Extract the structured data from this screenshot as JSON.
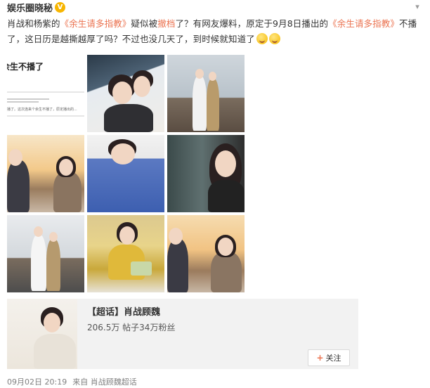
{
  "post": {
    "author": "娱乐圈晓秘",
    "verified_badge": "V",
    "more_icon": "chevron-down-icon",
    "text_parts": [
      {
        "t": "肖战和杨紫的",
        "hl": false
      },
      {
        "t": "《余生请多指教》",
        "hl": true
      },
      {
        "t": "疑似被",
        "hl": false
      },
      {
        "t": "撤档",
        "hl": true
      },
      {
        "t": "了？有网友爆料，原定于9月8日播出的",
        "hl": false
      },
      {
        "t": "《余生请多指教》",
        "hl": true
      },
      {
        "t": "不播了，这日历是越撕越厚了吗？不过也没几天了，到时候就知道了",
        "hl": false
      }
    ],
    "emoji_names": [
      "smile-emoji",
      "smile-emoji"
    ]
  },
  "grid": {
    "tile1": {
      "title": "余生不播了",
      "snippet": "播了。这次连来个余生不播了，原定播出的..."
    }
  },
  "supertopic": {
    "title": "【超话】肖战顾魏",
    "stats": "206.5万  帖子34万粉丝",
    "follow_label": "关注",
    "plus_icon": "plus-icon"
  },
  "footer": {
    "date": "09月02日 20:19",
    "source": "来自 肖战顾魏超话"
  },
  "colors": {
    "highlight": "#eb7350",
    "verified": "#f7b500"
  }
}
